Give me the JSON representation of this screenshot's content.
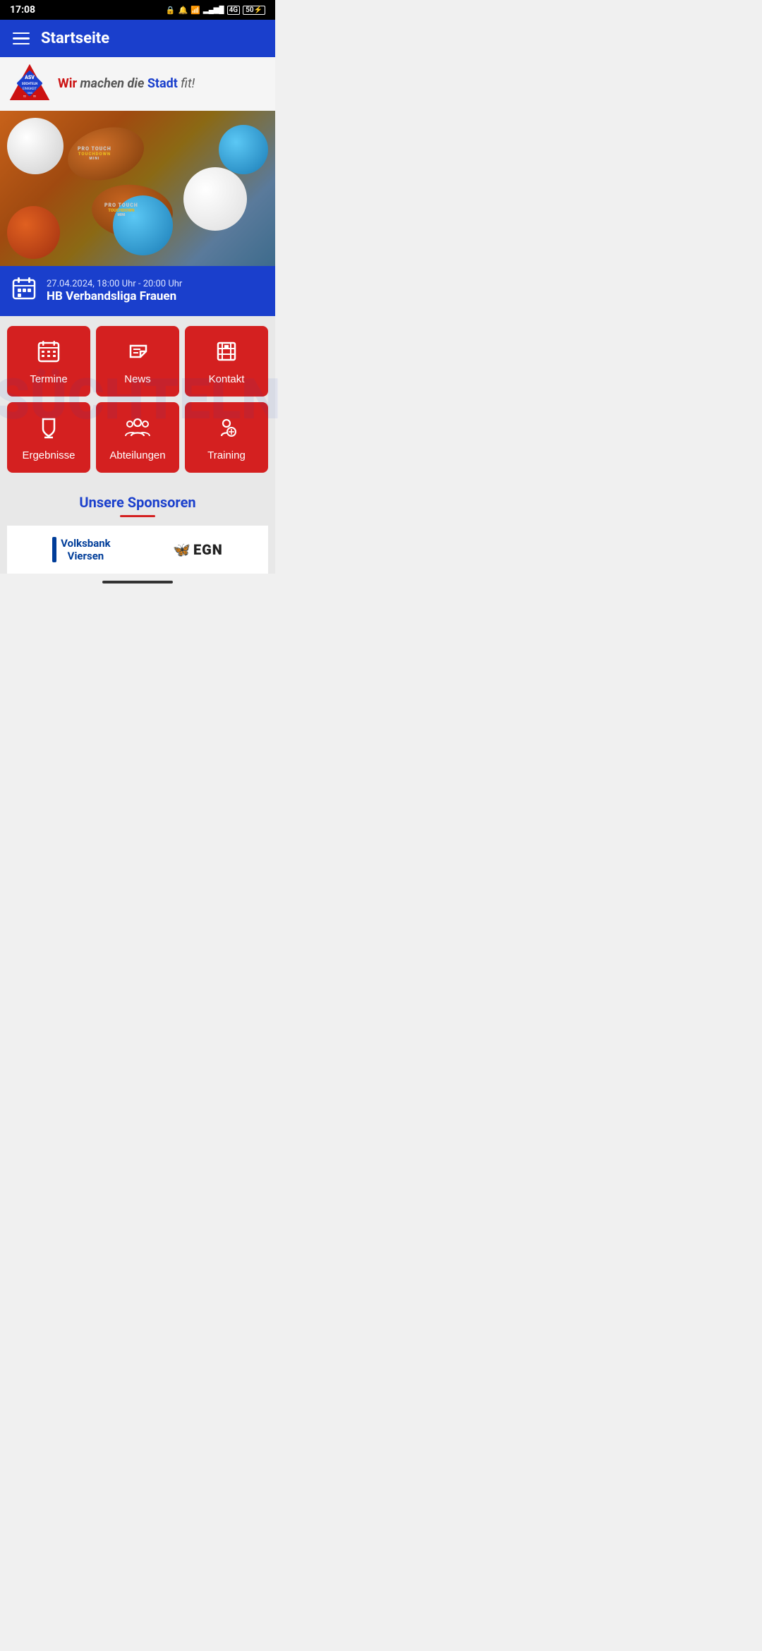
{
  "statusBar": {
    "time": "17:08",
    "icons": "🔒 🔔 📶 4G 50"
  },
  "topNav": {
    "title": "Startseite"
  },
  "tagline": {
    "wir": "Wir",
    "machen": " machen ",
    "die": "die ",
    "stadt": "Stadt",
    "fit": " fit!"
  },
  "eventCard": {
    "date": "27.04.2024, 18:00 Uhr - 20:00 Uhr",
    "title": "HB Verbandsliga Frauen"
  },
  "gridButtons": [
    {
      "id": "termine",
      "label": "Termine",
      "icon": "calendar"
    },
    {
      "id": "news",
      "label": "News",
      "icon": "megaphone"
    },
    {
      "id": "kontakt",
      "label": "Kontakt",
      "icon": "contact"
    },
    {
      "id": "ergebnisse",
      "label": "Ergebnisse",
      "icon": "trophy"
    },
    {
      "id": "abteilungen",
      "label": "Abteilungen",
      "icon": "group"
    },
    {
      "id": "training",
      "label": "Training",
      "icon": "training"
    }
  ],
  "sponsors": {
    "title": "Unsere Sponsoren",
    "volksbank": "Volksbank Viersen",
    "egn": "EGN"
  }
}
